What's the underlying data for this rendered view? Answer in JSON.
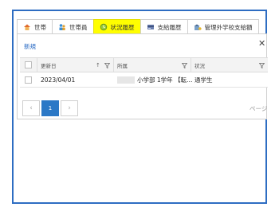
{
  "tabs": [
    {
      "label": "世帯",
      "icon": "house-icon"
    },
    {
      "label": "世帯員",
      "icon": "people-icon"
    },
    {
      "label": "状況履歴",
      "icon": "status-history-icon"
    },
    {
      "label": "支給履歴",
      "icon": "payment-history-icon"
    },
    {
      "label": "管理外学校支給額",
      "icon": "school-payment-icon"
    }
  ],
  "active_tab": "状況履歴",
  "toolbar": {
    "new_label": "新規",
    "close_glyph": "✕"
  },
  "grid": {
    "columns": [
      "更新日",
      "所属",
      "状況"
    ],
    "sort_glyph": "↑",
    "rows": [
      {
        "date": "2023/04/01",
        "affiliation": "小学部 1学年 【転…",
        "status": "通学生"
      }
    ]
  },
  "pager": {
    "prev": "‹",
    "current": "1",
    "next": "›",
    "info": "ページ"
  },
  "colors": {
    "accent": "#2b78c6",
    "frame": "#2e6dc2",
    "highlight": "#fffe00"
  }
}
